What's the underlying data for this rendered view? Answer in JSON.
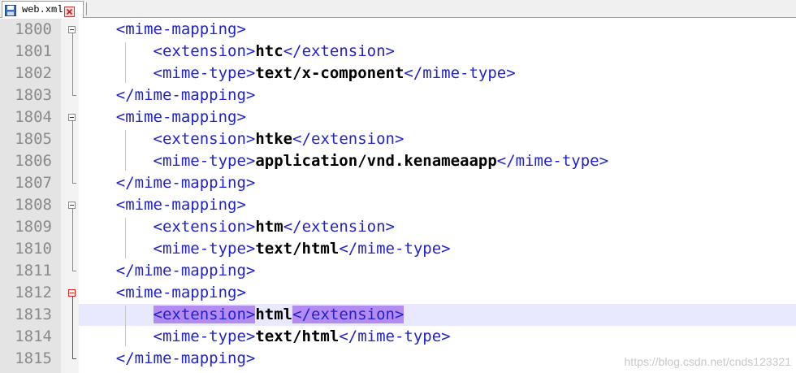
{
  "tab": {
    "label": "web.xml",
    "icon": "save-disk-icon",
    "close_icon": "close-icon"
  },
  "watermark": "https://blog.csdn.net/cnds123321",
  "colors": {
    "tag": "#2222cc",
    "highlight": "#b48cf0",
    "current_line": "#e8e8ff",
    "fold_active": "#e01b1b"
  },
  "lines": [
    {
      "num": "1800",
      "indent": "    ",
      "open": "<mime-mapping>",
      "value": "",
      "close": ""
    },
    {
      "num": "1801",
      "indent": "        ",
      "open": "<extension>",
      "value": "htc",
      "close": "</extension>"
    },
    {
      "num": "1802",
      "indent": "        ",
      "open": "<mime-type>",
      "value": "text/x-component",
      "close": "</mime-type>"
    },
    {
      "num": "1803",
      "indent": "    ",
      "open": "</mime-mapping>",
      "value": "",
      "close": ""
    },
    {
      "num": "1804",
      "indent": "    ",
      "open": "<mime-mapping>",
      "value": "",
      "close": ""
    },
    {
      "num": "1805",
      "indent": "        ",
      "open": "<extension>",
      "value": "htke",
      "close": "</extension>"
    },
    {
      "num": "1806",
      "indent": "        ",
      "open": "<mime-type>",
      "value": "application/vnd.kenameaapp",
      "close": "</mime-type>"
    },
    {
      "num": "1807",
      "indent": "    ",
      "open": "</mime-mapping>",
      "value": "",
      "close": ""
    },
    {
      "num": "1808",
      "indent": "    ",
      "open": "<mime-mapping>",
      "value": "",
      "close": ""
    },
    {
      "num": "1809",
      "indent": "        ",
      "open": "<extension>",
      "value": "htm",
      "close": "</extension>"
    },
    {
      "num": "1810",
      "indent": "        ",
      "open": "<mime-type>",
      "value": "text/html",
      "close": "</mime-type>"
    },
    {
      "num": "1811",
      "indent": "    ",
      "open": "</mime-mapping>",
      "value": "",
      "close": ""
    },
    {
      "num": "1812",
      "indent": "    ",
      "open": "<mime-mapping>",
      "value": "",
      "close": ""
    },
    {
      "num": "1813",
      "indent": "        ",
      "open": "<extension>",
      "value": "html",
      "close": "</extension>"
    },
    {
      "num": "1814",
      "indent": "        ",
      "open": "<mime-type>",
      "value": "text/html",
      "close": "</mime-type>"
    },
    {
      "num": "1815",
      "indent": "    ",
      "open": "</mime-mapping>",
      "value": "",
      "close": ""
    }
  ]
}
